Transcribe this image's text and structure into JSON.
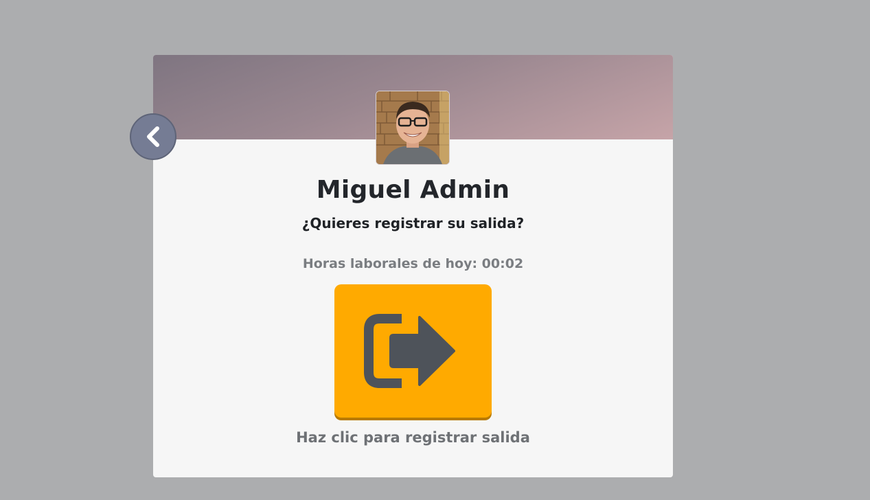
{
  "user": {
    "name": "Miguel Admin"
  },
  "prompt": {
    "question": "¿Quieres registrar su salida?"
  },
  "hours": {
    "label": "Horas laborales de hoy: 00:02"
  },
  "exit_button": {
    "icon": "sign-out-icon",
    "color": "#ffaa00",
    "icon_color": "#4e535a"
  },
  "footer": {
    "label": "Haz clic para registrar salida"
  },
  "back_button": {
    "icon": "chevron-left-icon",
    "color": "#757c94"
  },
  "colors": {
    "background": "#acadaf",
    "card": "#f6f6f6",
    "header_gradient_start": "#7f7581",
    "header_gradient_end": "#c6a4a8"
  }
}
